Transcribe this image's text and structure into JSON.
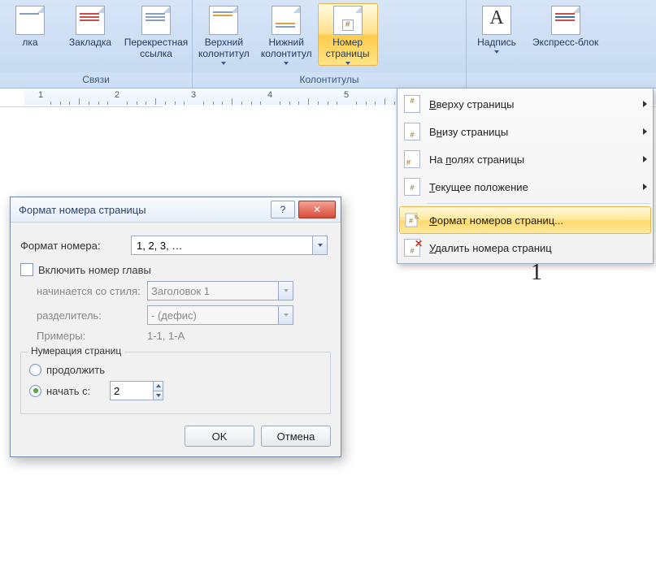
{
  "ribbon": {
    "groups": [
      {
        "title": "Связи",
        "items": [
          {
            "label": "лка"
          },
          {
            "label": "Закладка"
          },
          {
            "label": "Перекрестная\nссылка"
          }
        ]
      },
      {
        "title": "Колонтитулы",
        "items": [
          {
            "label": "Верхний\nколонтитул"
          },
          {
            "label": "Нижний\nколонтитул"
          },
          {
            "label": "Номер\nстраницы",
            "active": true
          }
        ]
      },
      {
        "title": "",
        "items": [
          {
            "label": "Надпись"
          },
          {
            "label": "Экспресс-блок"
          }
        ]
      }
    ]
  },
  "ruler": {
    "start": 1,
    "end": 8
  },
  "dropdown": {
    "items": [
      {
        "label": "Вверху страницы",
        "underline": 0,
        "arrow": true
      },
      {
        "label": "Внизу страницы",
        "underline": 1,
        "arrow": true
      },
      {
        "label": "На полях страницы",
        "underline": 3,
        "arrow": true
      },
      {
        "label": "Текущее положение",
        "underline": 0,
        "arrow": true
      },
      {
        "label": "Формат номеров страниц...",
        "underline": 0,
        "highlight": true,
        "icon": "fmt"
      },
      {
        "label": "Удалить номера страниц",
        "underline": 0,
        "icon": "del"
      }
    ]
  },
  "page": {
    "number_display": "1"
  },
  "dialog": {
    "title": "Формат номера страницы",
    "labels": {
      "format": "Формат номера:",
      "include_chapter": "Включить номер главы",
      "starts_style": "начинается со стиля:",
      "separator": "разделитель:",
      "examples": "Примеры:",
      "numbering_legend": "Нумерация страниц",
      "continue": "продолжить",
      "start_at": "начать с:",
      "ok": "OK",
      "cancel": "Отмена"
    },
    "values": {
      "format_combo": "1, 2, 3, …",
      "starts_style": "Заголовок 1",
      "separator": "-    (дефис)",
      "examples": "1-1, 1-A",
      "start_at": "2"
    },
    "state": {
      "include_chapter_checked": false,
      "numbering_selected": "start_at"
    }
  }
}
